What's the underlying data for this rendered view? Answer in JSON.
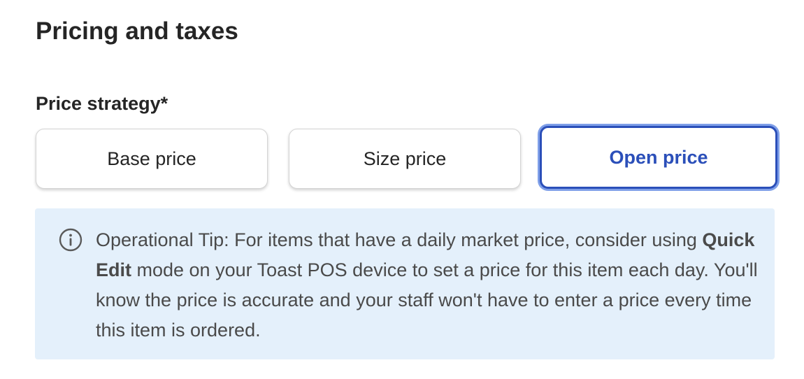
{
  "section": {
    "title": "Pricing and taxes"
  },
  "price_strategy": {
    "label": "Price strategy*",
    "options": [
      {
        "label": "Base price",
        "selected": false
      },
      {
        "label": "Size price",
        "selected": false
      },
      {
        "label": "Open price",
        "selected": true
      }
    ],
    "accent_color": "#2b4fb9"
  },
  "tip": {
    "icon": "info-icon",
    "text_before": "Operational Tip: For items that have a daily market price, consider using ",
    "bold_text": "Quick Edit",
    "text_after": " mode on your Toast POS device to set a price for this item each day. You'll know the price is accurate and your staff won't have to enter a price every time this item is ordered.",
    "background_color": "#e4f0fb"
  }
}
